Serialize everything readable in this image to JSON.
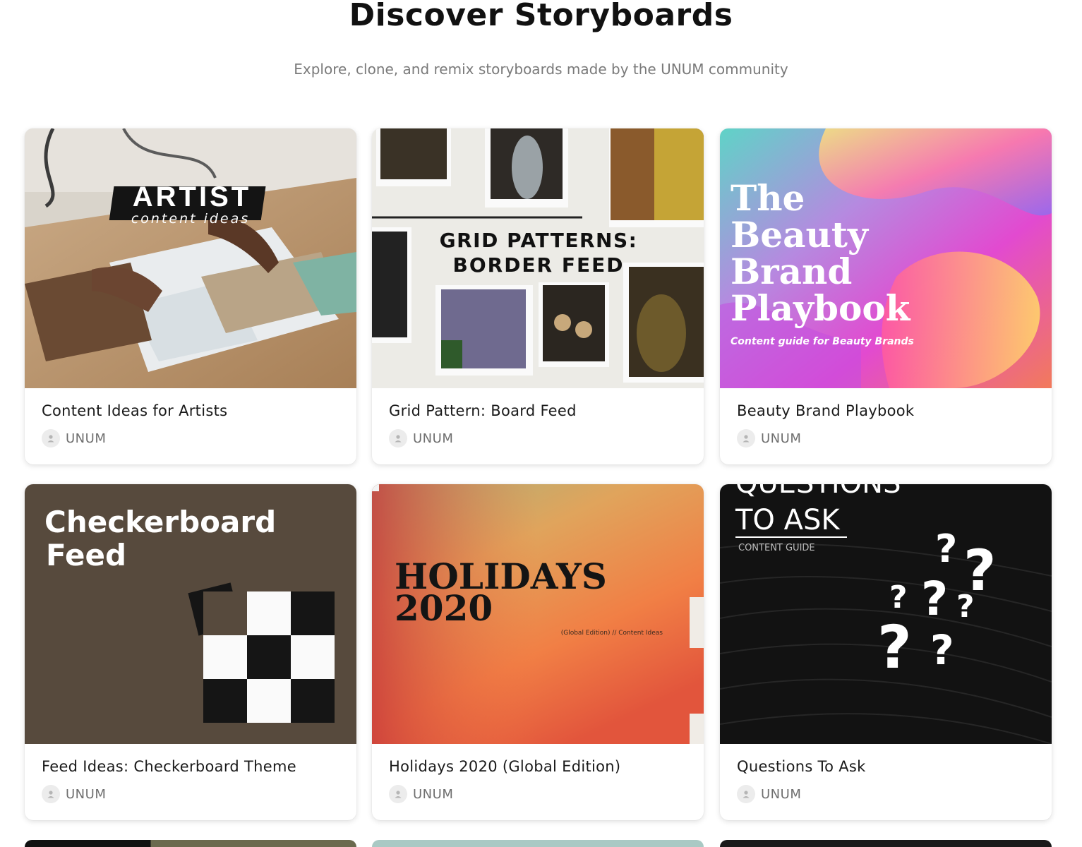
{
  "header": {
    "title": "Discover Storyboards",
    "subtitle": "Explore, clone, and remix storyboards made by the UNUM community"
  },
  "cards": [
    {
      "title": "Content Ideas for Artists",
      "author": "UNUM",
      "thumbnail": {
        "heading": "ARTIST",
        "subheading": "content ideas"
      }
    },
    {
      "title": "Grid Pattern: Board Feed",
      "author": "UNUM",
      "thumbnail": {
        "line1": "GRID PATTERNS:",
        "line2": "BORDER FEED"
      }
    },
    {
      "title": "Beauty Brand Playbook",
      "author": "UNUM",
      "thumbnail": {
        "line1": "The",
        "line2": "Beauty",
        "line3": "Brand",
        "line4": "Playbook",
        "caption": "Content guide for Beauty Brands"
      }
    },
    {
      "title": "Feed Ideas: Checkerboard Theme",
      "author": "UNUM",
      "thumbnail": {
        "line1": "Checkerboard",
        "line2": "Feed"
      }
    },
    {
      "title": "Holidays 2020 (Global Edition)",
      "author": "UNUM",
      "thumbnail": {
        "line1": "HOLIDAYS",
        "line2": "2020",
        "caption": "(Global Edition) // Content Ideas"
      }
    },
    {
      "title": "Questions To Ask",
      "author": "UNUM",
      "thumbnail": {
        "line1": "QUESTIONS",
        "line2": "TO ASK",
        "caption": "CONTENT GUIDE"
      }
    }
  ],
  "colors": {
    "background": "#ffffff",
    "title": "#111111",
    "subtitle": "#7a7a7a",
    "author": "#6f6f6f",
    "checkerboard_bg": "#574a3d"
  },
  "icons": {
    "avatar": "user-avatar-icon"
  }
}
